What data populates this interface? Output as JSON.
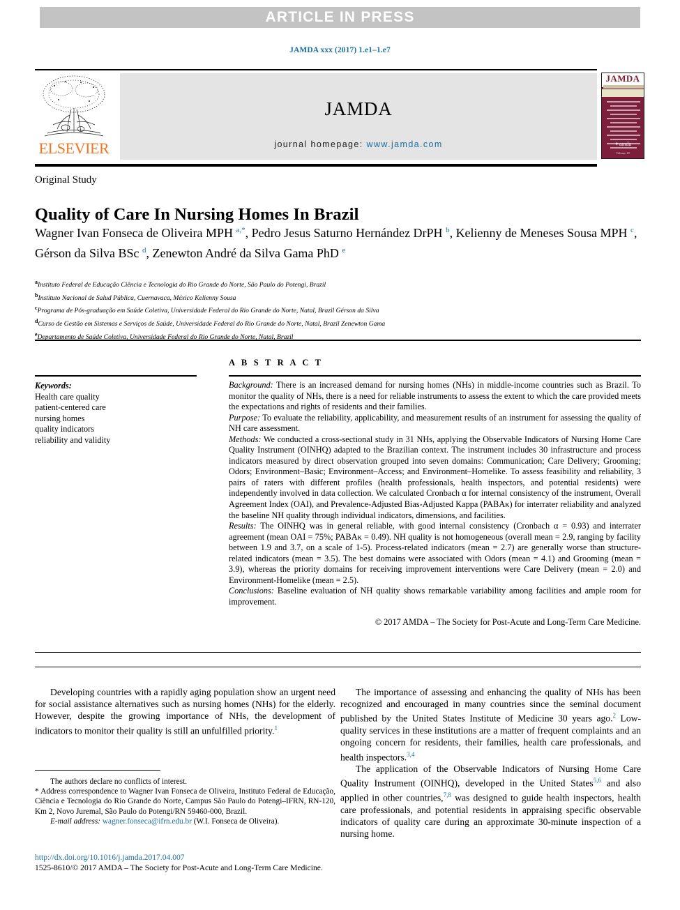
{
  "banner": {
    "text": "ARTICLE IN PRESS"
  },
  "citation": "JAMDA xxx (2017) 1.e1–1.e7",
  "journal_header": {
    "publisher": "ELSEVIER",
    "journal_name": "JAMDA",
    "homepage_label": "journal homepage:",
    "homepage_url": "www.jamda.com",
    "cover": {
      "title": "JAMDA",
      "logo_text": "✦amda",
      "footer_text": "Volume 18"
    },
    "colors": {
      "accent_link": "#1a6ea0",
      "elsevier_orange": "#ef7622",
      "band_grey": "#e4e4e4",
      "banner_grey": "#c3c3c3",
      "cover_maroon": "#7c1e3c"
    }
  },
  "article": {
    "section_label": "Original Study",
    "title": "Quality of Care In Nursing Homes In Brazil",
    "authors_html": "Wagner Ivan Fonseca de Oliveira MPH <sup>a,*</sup>, Pedro Jesus Saturno Hernández DrPH <sup>b</sup>, Kelienny de Meneses Sousa MPH <sup>c</sup>, Gérson da Silva BSc <sup>d</sup>, Zenewton André da Silva Gama PhD <sup>e</sup>",
    "affiliations": [
      {
        "marker": "a",
        "text": "Instituto Federal de Educação Ciência e Tecnologia do Rio Grande do Norte, São Paulo do Potengi, Brazil"
      },
      {
        "marker": "b",
        "text": "Instituto Nacional de Salud Pública, Cuernavaca, México Kelienny Sousa"
      },
      {
        "marker": "c",
        "text": "Programa de Pós-graduação em Saúde Coletiva, Universidade Federal do Rio Grande do Norte, Natal, Brazil Gérson da Silva"
      },
      {
        "marker": "d",
        "text": "Curso de Gestão em Sistemas e Serviços de Saúde, Universidade Federal do Rio Grande do Norte, Natal, Brazil Zenewton Gama"
      },
      {
        "marker": "e",
        "text": "Departamento de Saúde Coletiva, Universidade Federal do Rio Grande do Norte, Natal, Brazil"
      }
    ]
  },
  "keywords": {
    "heading": "Keywords:",
    "items": [
      "Health care quality",
      "patient-centered care",
      "nursing homes",
      "quality indicators",
      "reliability and validity"
    ]
  },
  "abstract": {
    "heading": "A B S T R A C T",
    "sections": [
      {
        "label": "Background:",
        "text": " There is an increased demand for nursing homes (NHs) in middle-income countries such as Brazil. To monitor the quality of NHs, there is a need for reliable instruments to assess the extent to which the care provided meets the expectations and rights of residents and their families."
      },
      {
        "label": "Purpose:",
        "text": " To evaluate the reliability, applicability, and measurement results of an instrument for assessing the quality of NH care assessment."
      },
      {
        "label": "Methods:",
        "text": " We conducted a cross-sectional study in 31 NHs, applying the Observable Indicators of Nursing Home Care Quality Instrument (OINHQ) adapted to the Brazilian context. The instrument includes 30 infrastructure and process indicators measured by direct observation grouped into seven domains: Communication; Care Delivery; Grooming; Odors; Environment–Basic; Environment–Access; and Environment–Homelike. To assess feasibility and reliability, 3 pairs of raters with different profiles (health professionals, health inspectors, and potential residents) were independently involved in data collection. We calculated Cronbach α for internal consistency of the instrument, Overall Agreement Index (OAI), and Prevalence-Adjusted Bias-Adjusted Kappa (PABAκ) for interrater reliability and analyzed the baseline NH quality through individual indicators, dimensions, and facilities."
      },
      {
        "label": "Results:",
        "text": " The OINHQ was in general reliable, with good internal consistency (Cronbach α = 0.93) and interrater agreement (mean OAI = 75%; PABAκ = 0.49). NH quality is not homogeneous (overall mean = 2.9, ranging by facility between 1.9 and 3.7, on a scale of 1-5). Process-related indicators (mean = 2.7) are generally worse than structure-related indicators (mean = 3.5). The best domains were associated with Odors (mean = 4.1) and Grooming (mean = 3.9), whereas the priority domains for receiving improvement interventions were Care Delivery (mean = 2.0) and Environment-Homelike (mean = 2.5)."
      },
      {
        "label": "Conclusions:",
        "text": " Baseline evaluation of NH quality shows remarkable variability among facilities and ample room for improvement."
      }
    ],
    "copyright": "© 2017 AMDA – The Society for Post-Acute and Long-Term Care Medicine."
  },
  "body": {
    "left_column": [
      "Developing countries with a rapidly aging population show an urgent need for social assistance alternatives such as nursing homes (NHs) for the elderly. However, despite the growing importance of NHs, the development of indicators to monitor their quality is still an unfulfilled priority."
    ],
    "left_column_refs": [
      "1"
    ],
    "right_column": [
      {
        "text": "The importance of assessing and enhancing the quality of NHs has been recognized and encouraged in many countries since the seminal document published by the United States Institute of Medicine 30 years ago.",
        "ref": "2",
        "tail": " Low-quality services in these institutions are a matter of frequent complaints and an ongoing concern for residents, their families, health care professionals, and health inspectors.",
        "tail_ref": "3,4"
      },
      {
        "text": "The application of the Observable Indicators of Nursing Home Care Quality Instrument (OINHQ), developed in the United States",
        "ref": "5,6",
        "tail": " and also applied in other countries,",
        "tail_ref": "7,8",
        "tail2": " was designed to guide health inspectors, health care professionals, and potential residents in appraising specific observable indicators of quality care during an approximate 30-minute inspection of a nursing home."
      }
    ]
  },
  "footnotes": {
    "conflict": "The authors declare no conflicts of interest.",
    "correspondence_marker": "*",
    "correspondence": " Address correspondence to Wagner Ivan Fonseca de Oliveira, Instituto Federal de Educação, Ciência e Tecnologia do Rio Grande do Norte, Campus São Paulo do Potengi–IFRN, RN-120, Km 2, Novo Juremal, São Paulo do Potengi/RN 59460-000, Brazil.",
    "email_label": "E-mail address:",
    "email": "wagner.fonseca@ifrn.edu.br",
    "email_owner": "(W.I. Fonseca de Oliveira)."
  },
  "doi_block": {
    "doi_url": "http://dx.doi.org/10.1016/j.jamda.2017.04.007",
    "issn_line": "1525-8610/© 2017 AMDA – The Society for Post-Acute and Long-Term Care Medicine."
  }
}
